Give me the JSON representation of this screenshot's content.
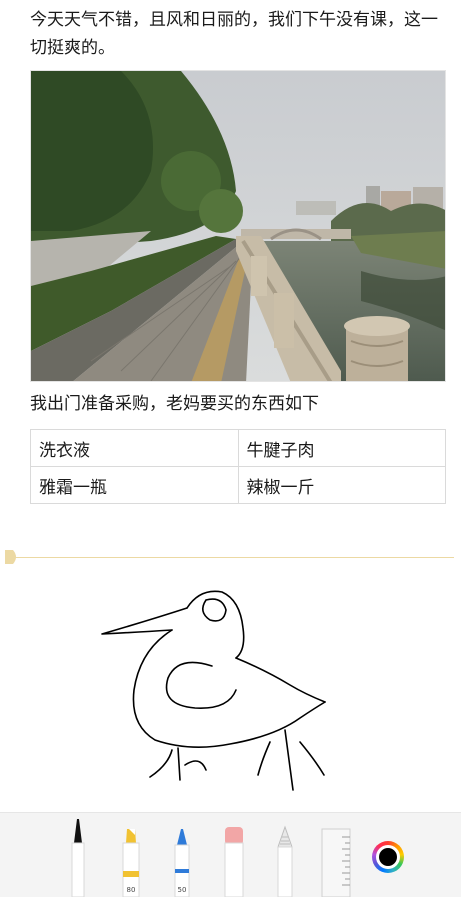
{
  "note": {
    "paragraph": "今天天气不错，且风和日丽的，我们下午没有课，这一切挺爽的。",
    "photo_icon": "riverside-walkway-photo",
    "caption": "我出门准备采购，老妈要买的东西如下",
    "table": {
      "rows": [
        [
          "洗衣液",
          "牛腱子肉"
        ],
        [
          "雅霜一瓶",
          "辣椒一斤"
        ]
      ]
    }
  },
  "drawing": {
    "sketch_icon": "bird-sketch",
    "divider_icon": "drawing-area-handle-icon"
  },
  "toolbar": {
    "tools": [
      {
        "icon": "pen-tool-icon"
      },
      {
        "icon": "highlighter-tool-icon",
        "value": "80"
      },
      {
        "icon": "pencil-blue-tool-icon",
        "value": "50"
      },
      {
        "icon": "eraser-tool-icon"
      },
      {
        "icon": "crayon-tool-icon"
      },
      {
        "icon": "ruler-tool-icon"
      }
    ],
    "color_picker_icon": "color-picker-icon",
    "selected_color": "#000000"
  }
}
